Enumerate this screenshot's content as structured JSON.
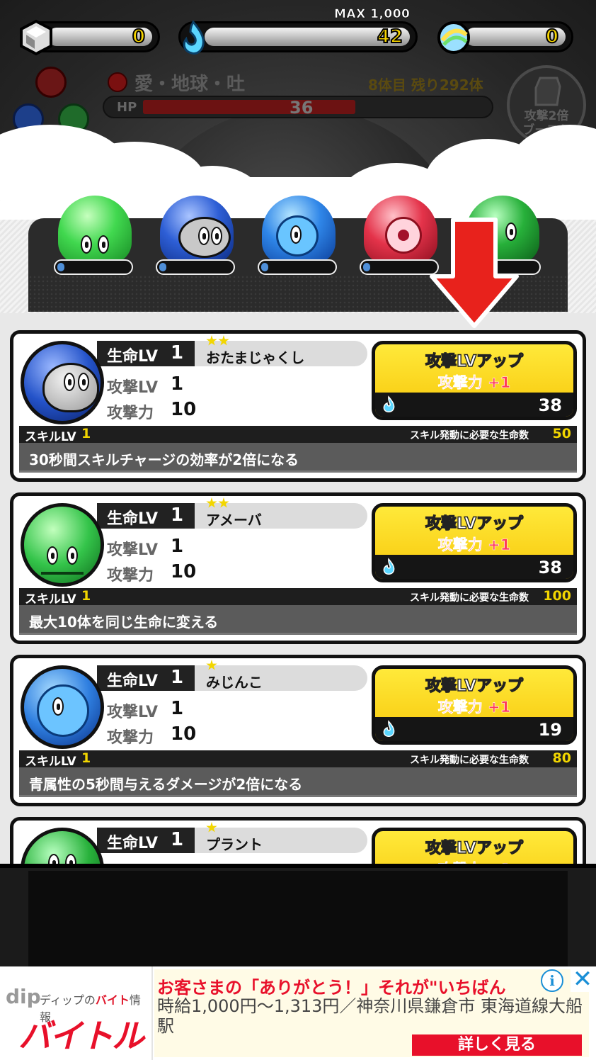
{
  "hud": {
    "gem_count": "0",
    "soul_max_label": "MAX 1,000",
    "soul_count": "42",
    "orb_count": "0",
    "enemy_name": "愛・地球・吐",
    "wave_text": "8体目 残り292体",
    "hp_label": "HP",
    "hp_value": "36",
    "boost_line1": "攻撃2倍",
    "boost_line2": "ブースト"
  },
  "team": [
    {
      "icon": "green-blob-icon",
      "color": "#3fd34a"
    },
    {
      "icon": "grey-blob-icon",
      "color": "#2e5fd6"
    },
    {
      "icon": "blue-fish-icon",
      "color": "#2f86e8"
    },
    {
      "icon": "red-eye-icon",
      "color": "#e4334a"
    },
    {
      "icon": "green-plant-icon",
      "color": "#27b03a"
    }
  ],
  "labels": {
    "life_lv": "生命LV",
    "atk_lv": "攻撃LV",
    "atk": "攻撃力",
    "skill_lv": "スキルLV",
    "skill_need": "スキル発動に必要な生命数",
    "upgrade_title": "攻撃LVアップ",
    "upgrade_effect": "攻撃力 +1"
  },
  "units": [
    {
      "name": "おたまじゃくし",
      "stars": 2,
      "life_lv": "1",
      "atk_lv": "1",
      "atk": "10",
      "cost": "38",
      "skill_lv": "1",
      "skill_need": "50",
      "skill_desc": "30秒間スキルチャージの効率が2倍になる",
      "body_color": "#2453c9"
    },
    {
      "name": "アメーバ",
      "stars": 2,
      "life_lv": "1",
      "atk_lv": "1",
      "atk": "10",
      "cost": "38",
      "skill_lv": "1",
      "skill_need": "100",
      "skill_desc": "最大10体を同じ生命に変える",
      "body_color": "#34c44a"
    },
    {
      "name": "みじんこ",
      "stars": 1,
      "life_lv": "1",
      "atk_lv": "1",
      "atk": "10",
      "cost": "19",
      "skill_lv": "1",
      "skill_need": "80",
      "skill_desc": "青属性の5秒間与えるダメージが2倍になる",
      "body_color": "#2f7fe0"
    },
    {
      "name": "プラント",
      "stars": 1,
      "life_lv": "1",
      "atk_lv": "",
      "atk": "",
      "cost": "",
      "skill_lv": "",
      "skill_need": "",
      "skill_desc": "",
      "body_color": "#29b23c"
    }
  ],
  "ad": {
    "dip": "dip",
    "sub_prefix": "ディップの",
    "sub_highlight": "バイト",
    "sub_suffix": "情報",
    "brand": "バイトル",
    "headline": "お客さまの「ありがとう！」それが\"いちばん",
    "body": "時給1,000円～1,313円／神奈川県鎌倉市 東海道線大船駅",
    "cta": "詳しく見る",
    "info": "i",
    "close": "✕"
  }
}
